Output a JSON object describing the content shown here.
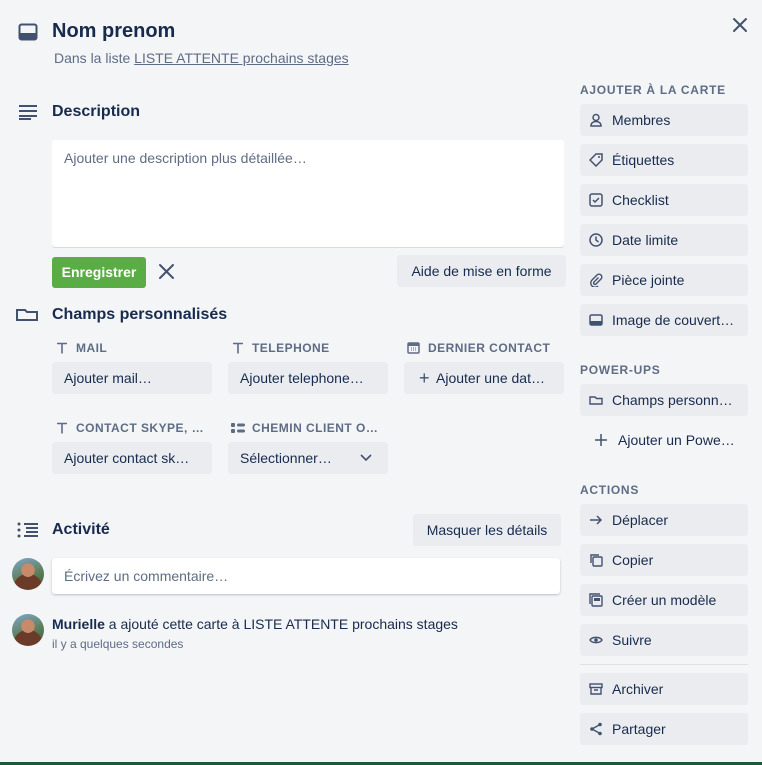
{
  "card": {
    "title": "Nom prenom",
    "in_list_prefix": "Dans la liste",
    "list_name": "LISTE ATTENTE prochains stages"
  },
  "description": {
    "heading": "Description",
    "placeholder": "Ajouter une description plus détaillée…",
    "save_label": "Enregistrer",
    "format_help_label": "Aide de mise en forme"
  },
  "custom_fields": {
    "heading": "Champs personnalisés",
    "fields": [
      {
        "label": "MAIL",
        "value": "Ajouter mail…",
        "icon": "text-field-icon"
      },
      {
        "label": "TELEPHONE",
        "value": "Ajouter telephone…",
        "icon": "text-field-icon"
      },
      {
        "label": "DERNIER CONTACT",
        "value": "Ajouter une dat…",
        "icon": "calendar-icon"
      },
      {
        "label": "CONTACT SKYPE, …",
        "value": "Ajouter contact sk…",
        "icon": "text-field-icon"
      },
      {
        "label": "CHEMIN CLIENT O…",
        "value": "Sélectionner…",
        "icon": "dropdown-field-icon"
      }
    ]
  },
  "activity": {
    "heading": "Activité",
    "toggle_details_label": "Masquer les détails",
    "comment_placeholder": "Écrivez un commentaire…",
    "entries": [
      {
        "user": "Murielle",
        "action": "a ajouté cette carte à LISTE ATTENTE prochains stages",
        "time": "il y a quelques secondes"
      }
    ]
  },
  "sidebar": {
    "add_heading": "AJOUTER À LA CARTE",
    "add_items": [
      {
        "label": "Membres",
        "icon": "person-icon"
      },
      {
        "label": "Étiquettes",
        "icon": "label-icon"
      },
      {
        "label": "Checklist",
        "icon": "checklist-icon"
      },
      {
        "label": "Date limite",
        "icon": "clock-icon"
      },
      {
        "label": "Pièce jointe",
        "icon": "paperclip-icon"
      },
      {
        "label": "Image de couvert…",
        "icon": "cover-image-icon"
      }
    ],
    "powerups_heading": "POWER-UPS",
    "powerups_items": [
      {
        "label": "Champs personn…",
        "icon": "custom-fields-icon"
      },
      {
        "label": "Ajouter un Powe…",
        "icon": "plus-icon"
      }
    ],
    "actions_heading": "ACTIONS",
    "action_items": [
      {
        "label": "Déplacer",
        "icon": "arrow-right-icon"
      },
      {
        "label": "Copier",
        "icon": "copy-icon"
      },
      {
        "label": "Créer un modèle",
        "icon": "template-icon"
      },
      {
        "label": "Suivre",
        "icon": "eye-icon"
      }
    ],
    "extra_items": [
      {
        "label": "Archiver",
        "icon": "archive-icon"
      },
      {
        "label": "Partager",
        "icon": "share-icon"
      }
    ]
  }
}
